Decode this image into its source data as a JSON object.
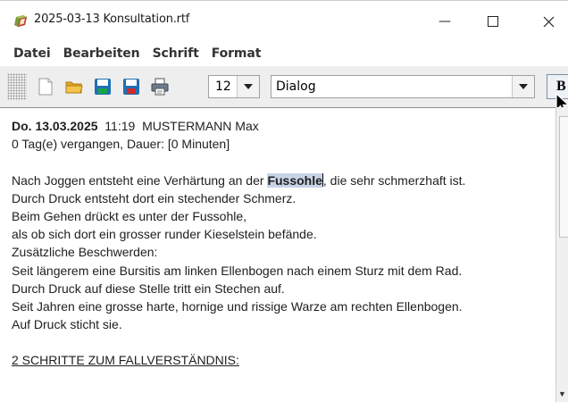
{
  "window": {
    "title": "2025-03-13 Konsultation.rtf",
    "minimize_glyph": "—",
    "maximize_glyph": "☐",
    "close_glyph": "✕"
  },
  "menu": {
    "items": [
      {
        "label": "Datei"
      },
      {
        "label": "Bearbeiten"
      },
      {
        "label": "Schrift"
      },
      {
        "label": "Format"
      }
    ]
  },
  "toolbar": {
    "icons": [
      "new-document-icon",
      "open-folder-icon",
      "save-icon",
      "save-as-icon",
      "print-icon"
    ],
    "font_size": "12",
    "font_name": "Dialog",
    "bold_label": "B"
  },
  "document": {
    "header_date": "Do. 13.03.2025",
    "header_rest": "  11:19  MUSTERMANN Max",
    "elapsed": "0 Tag(e) vergangen, Dauer: [0 Minuten]",
    "line1_before": "Nach Joggen entsteht eine Verhärtung an der ",
    "line1_highlight": "Fussohle",
    "line1_after": ", die sehr schmerzhaft ist.",
    "lines": [
      "Durch Druck entsteht dort ein stechender Schmerz.",
      "Beim Gehen drückt es unter der Fussohle,",
      "als ob sich dort ein grosser runder Kieselstein befände.",
      "Zusätzliche Beschwerden:",
      "Seit längerem eine Bursitis am linken Ellenbogen nach einem Sturz mit dem Rad.",
      "Durch Druck auf diese Stelle tritt ein Stechen auf.",
      "Seit Jahren eine grosse harte, hornige und rissige Warze am rechten Ellenbogen.",
      "Auf Druck sticht sie."
    ],
    "section_heading": "2 SCHRITTE ZUM FALLVERSTÄNDNIS:"
  },
  "colors": {
    "selection": "#c7d4e6",
    "toolbar_bg": "#eeeeee"
  }
}
